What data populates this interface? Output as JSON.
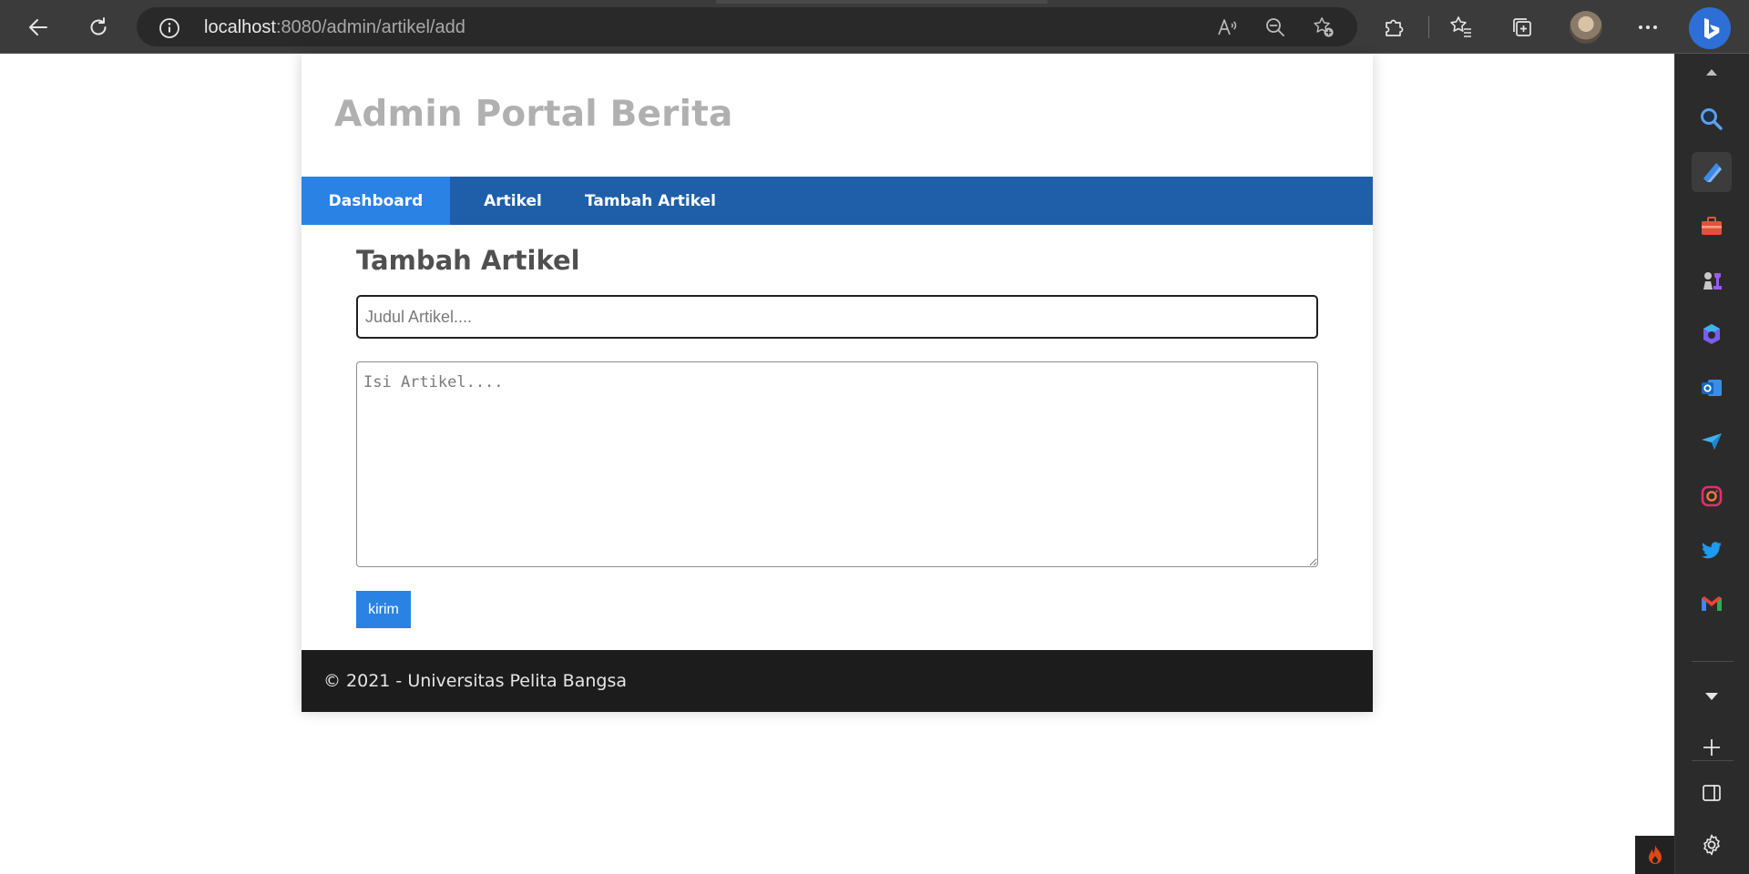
{
  "browser": {
    "url_host": "localhost",
    "url_path": ":8080/admin/artikel/add"
  },
  "site": {
    "title": "Admin Portal Berita"
  },
  "nav": {
    "items": [
      {
        "label": "Dashboard",
        "active": true
      },
      {
        "label": "Artikel",
        "active": false
      },
      {
        "label": "Tambah Artikel",
        "active": false
      }
    ]
  },
  "form": {
    "heading": "Tambah Artikel",
    "title_placeholder": "Judul Artikel....",
    "body_placeholder": "Isi Artikel....",
    "submit_label": "kirim"
  },
  "footer": {
    "text": "© 2021 - Universitas Pelita Bangsa"
  },
  "colors": {
    "nav_bg": "#1f5fa9",
    "nav_active": "#2a82e4",
    "button": "#2a82e4",
    "footer_bg": "#1c1c1c",
    "title_gray": "#b0b0b0"
  }
}
